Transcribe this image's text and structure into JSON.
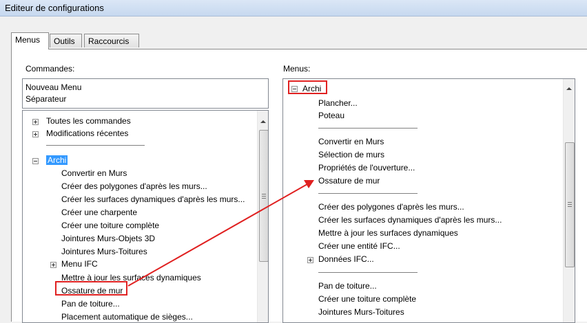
{
  "window": {
    "title": "Editeur de configurations"
  },
  "tabs": [
    "Menus",
    "Outils",
    "Raccourcis"
  ],
  "left": {
    "label": "Commandes:",
    "top_items": [
      "Nouveau Menu",
      "Séparateur"
    ],
    "tree": {
      "all_commands": "Toutes les commandes",
      "recent": "Modifications récentes",
      "archi": "Archi",
      "archi_children": [
        "Convertir en Murs",
        "Créer des polygones d'après les murs...",
        "Créer les surfaces dynamiques d'après les murs...",
        "Créer une charpente",
        "Créer une toiture complète",
        "Jointures Murs-Objets 3D",
        "Jointures Murs-Toitures"
      ],
      "menu_ifc": "Menu IFC",
      "after_ifc": [
        "Mettre à jour les surfaces dynamiques",
        "Ossature de mur",
        "Pan de toiture...",
        "Placement automatique de sièges..."
      ]
    }
  },
  "right": {
    "label": "Menus:",
    "archi": "Archi",
    "group1": [
      "Plancher...",
      "Poteau"
    ],
    "group2": [
      "Convertir en Murs",
      "Sélection de murs",
      "Propriétés de l'ouverture...",
      "Ossature de mur"
    ],
    "group3": [
      "Créer des polygones d'après les murs...",
      "Créer les surfaces dynamiques d'après les murs...",
      "Mettre à jour les surfaces dynamiques",
      "Créer une entité IFC..."
    ],
    "donnees_ifc": "Données IFC...",
    "group4": [
      "Pan de toiture...",
      "Créer une toiture complète",
      "Jointures Murs-Toitures"
    ]
  },
  "colors": {
    "highlight": "#3399ff",
    "annotation": "#e02020"
  }
}
